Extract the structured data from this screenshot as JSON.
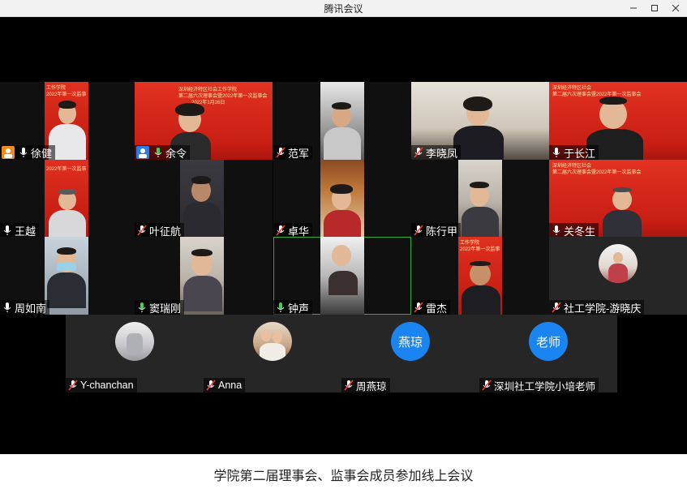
{
  "window": {
    "title": "腾讯会议"
  },
  "caption": "学院第二届理事会、监事会成员参加线上会议",
  "banners": {
    "a": "工作学院",
    "b": "2022年第一次监事",
    "c": "深圳经济特区社会工作学院",
    "d": "第二届六次理事会暨2022年第一次监事会",
    "e": "2022年1月26日",
    "f": "深圳经济特区社会",
    "g": "第二届六次理事会暨2022年第一次监事会"
  },
  "avatars": {
    "yanqiong": "燕琼",
    "laoshi": "老师"
  },
  "participants": [
    {
      "name": "徐健"
    },
    {
      "name": "余令"
    },
    {
      "name": "范军"
    },
    {
      "name": "李晓凤"
    },
    {
      "name": "于长江"
    },
    {
      "name": "王越"
    },
    {
      "name": "叶征航"
    },
    {
      "name": "卓华"
    },
    {
      "name": "陈行甲"
    },
    {
      "name": "关冬生"
    },
    {
      "name": "周如南"
    },
    {
      "name": "窦瑞刚"
    },
    {
      "name": "钟声"
    },
    {
      "name": "雷杰"
    },
    {
      "name": "社工学院-游晓庆"
    },
    {
      "name": "Y-chanchan"
    },
    {
      "name": "Anna"
    },
    {
      "name": "周燕琼"
    },
    {
      "name": "深圳社工学院小培老师"
    }
  ]
}
